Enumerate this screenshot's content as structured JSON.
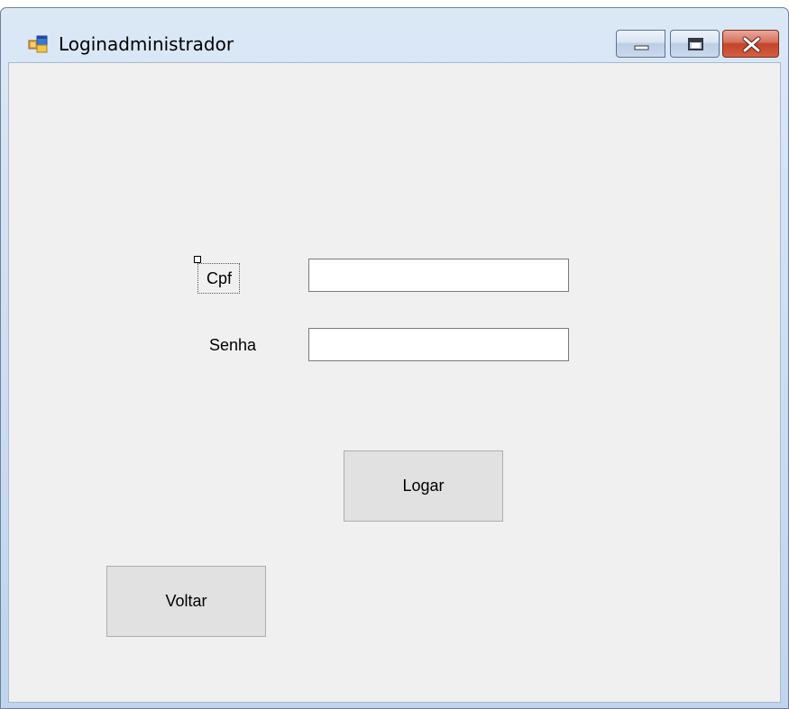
{
  "window": {
    "title": "Loginadministrador",
    "icon": "windows-form-icon"
  },
  "form": {
    "cpf_label": "Cpf",
    "cpf_value": "",
    "senha_label": "Senha",
    "senha_value": ""
  },
  "buttons": {
    "logar_label": "Logar",
    "voltar_label": "Voltar"
  },
  "colors": {
    "client_background": "#f0f0f0",
    "button_background": "#e1e1e1",
    "close_button": "#c3432b"
  }
}
